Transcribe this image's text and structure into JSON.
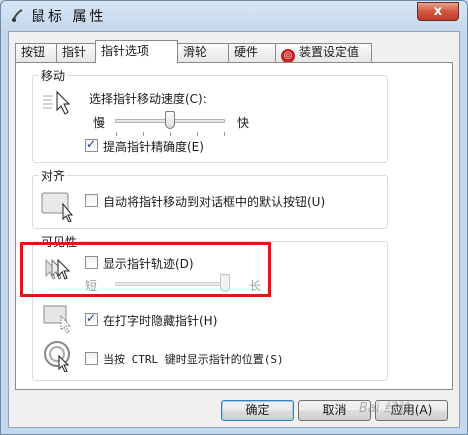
{
  "window": {
    "title": "鼠标 属性",
    "close_label": "x"
  },
  "tabs": [
    {
      "label": "按钮"
    },
    {
      "label": "指针"
    },
    {
      "label": "指针选项"
    },
    {
      "label": "滑轮"
    },
    {
      "label": "硬件"
    },
    {
      "label": "装置设定值"
    }
  ],
  "motion": {
    "title": "移动",
    "speed_label": "选择指针移动速度(C):",
    "slow": "慢",
    "fast": "快",
    "speed_level": 0.5,
    "precision_label": "提高指针精确度(E)",
    "precision_checked": true
  },
  "snap": {
    "title": "对齐",
    "label": "自动将指针移动到对话框中的默认按钮(U)",
    "checked": false
  },
  "visibility": {
    "title": "可见性",
    "trails_label": "显示指针轨迹(D)",
    "trails_checked": false,
    "short": "短",
    "long": "长",
    "trails_level": 1.0,
    "hide_label": "在打字时隐藏指针(H)",
    "hide_checked": true,
    "ctrl_label": "当按 CTRL 键时显示指针的位置(S)",
    "ctrl_checked": false
  },
  "buttons": {
    "ok": "确定",
    "cancel": "取消",
    "apply": "应用(A)"
  },
  "watermark": "Bai 经验"
}
